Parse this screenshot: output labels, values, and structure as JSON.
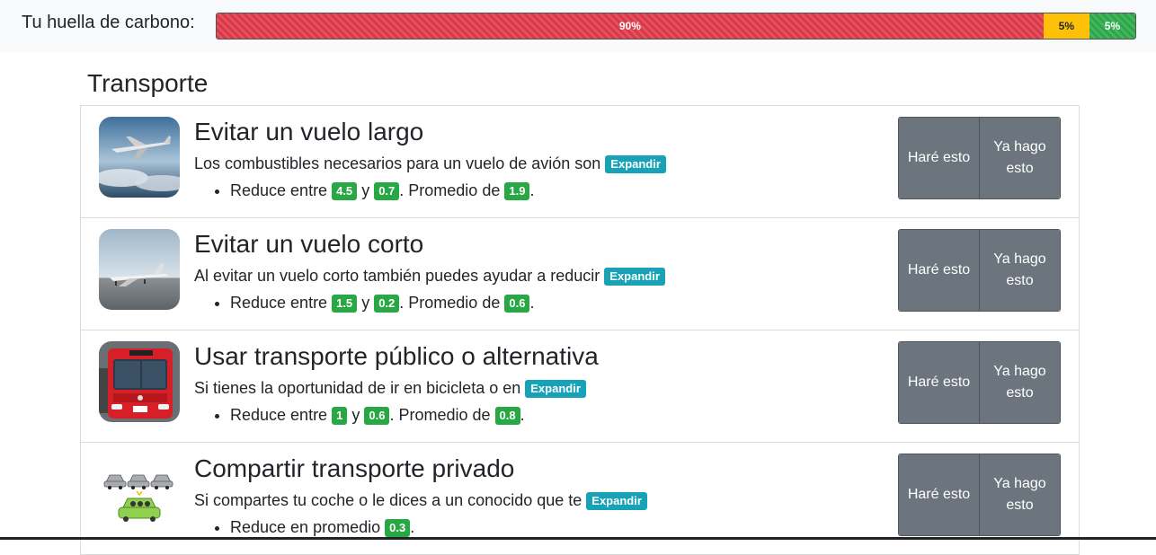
{
  "header": {
    "title": "Tu huella de carbono:",
    "segments": [
      {
        "label": "90%",
        "value": 90,
        "color": "#dc3545"
      },
      {
        "label": "5%",
        "value": 5,
        "color": "#ffc107"
      },
      {
        "label": "5%",
        "value": 5,
        "color": "#28a745"
      }
    ]
  },
  "section": {
    "title": "Transporte"
  },
  "items": [
    {
      "title": "Evitar un vuelo largo",
      "description": "Los combustibles necesarios para un vuelo de avión son",
      "expand_label": "Expandir",
      "reduce_prefix": "Reduce entre",
      "min": "4.5",
      "and": "y",
      "max": "0.7",
      "avg_label": ". Promedio de",
      "avg": "1.9",
      "end": ".",
      "btn_will": "Haré esto",
      "btn_already": "Ya hago esto"
    },
    {
      "title": "Evitar un vuelo corto",
      "description": "Al evitar un vuelo corto también puedes ayudar a reducir",
      "expand_label": "Expandir",
      "reduce_prefix": "Reduce entre",
      "min": "1.5",
      "and": "y",
      "max": "0.2",
      "avg_label": ". Promedio de",
      "avg": "0.6",
      "end": ".",
      "btn_will": "Haré esto",
      "btn_already": "Ya hago esto"
    },
    {
      "title": "Usar transporte público o alternativa",
      "description": "Si tienes la oportunidad de ir en bicicleta o en",
      "expand_label": "Expandir",
      "reduce_prefix": "Reduce entre",
      "min": "1",
      "and": "y",
      "max": "0.6",
      "avg_label": ". Promedio de",
      "avg": "0.8",
      "end": ".",
      "btn_will": "Haré esto",
      "btn_already": "Ya hago esto"
    },
    {
      "title": "Compartir transporte privado",
      "description": "Si compartes tu coche o le dices a un conocido que te",
      "expand_label": "Expandir",
      "reduce_prefix": "Reduce en promedio",
      "avg": "0.3",
      "end": ".",
      "btn_will": "Haré esto",
      "btn_already": "Ya hago esto"
    }
  ]
}
